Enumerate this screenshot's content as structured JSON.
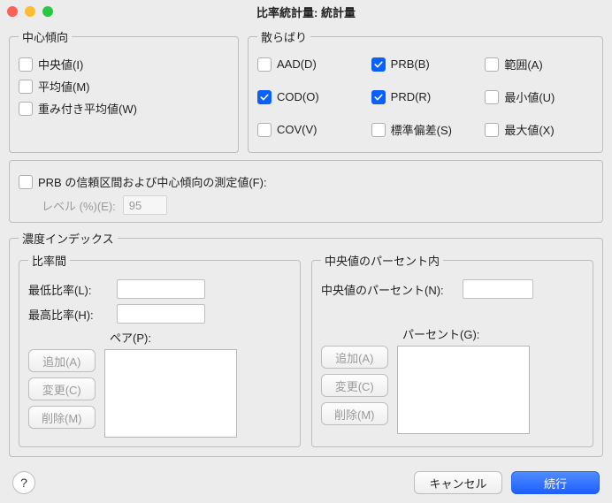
{
  "window": {
    "title": "比率統計量: 統計量"
  },
  "central": {
    "legend": "中心傾向",
    "items": [
      {
        "label": "中央値(I)",
        "checked": false,
        "name": "chk-median"
      },
      {
        "label": "平均値(M)",
        "checked": false,
        "name": "chk-mean"
      },
      {
        "label": "重み付き平均値(W)",
        "checked": false,
        "name": "chk-weighted-mean"
      }
    ]
  },
  "dispersion": {
    "legend": "散らばり",
    "items": [
      {
        "label": "AAD(D)",
        "checked": false,
        "name": "chk-aad"
      },
      {
        "label": "PRB(B)",
        "checked": true,
        "name": "chk-prb"
      },
      {
        "label": "範囲(A)",
        "checked": false,
        "name": "chk-range"
      },
      {
        "label": "COD(O)",
        "checked": true,
        "name": "chk-cod"
      },
      {
        "label": "PRD(R)",
        "checked": true,
        "name": "chk-prd"
      },
      {
        "label": "最小値(U)",
        "checked": false,
        "name": "chk-min"
      },
      {
        "label": "COV(V)",
        "checked": false,
        "name": "chk-cov"
      },
      {
        "label": "標準偏差(S)",
        "checked": false,
        "name": "chk-stddev"
      },
      {
        "label": "最大値(X)",
        "checked": false,
        "name": "chk-max"
      }
    ]
  },
  "prbSection": {
    "confLabel": "PRB の信頼区間および中心傾向の測定値(F):",
    "confChecked": false,
    "levelLabel": "レベル (%)(E):",
    "levelValue": "95"
  },
  "concentration": {
    "legend": "濃度インデックス",
    "ratio": {
      "legend": "比率間",
      "minLabel": "最低比率(L):",
      "maxLabel": "最高比率(H):",
      "minValue": "",
      "maxValue": "",
      "pairLabel": "ペア(P):",
      "addLabel": "追加(A)",
      "changeLabel": "変更(C)",
      "removeLabel": "削除(M)"
    },
    "median": {
      "legend": "中央値のパーセント内",
      "pctOfMedianLabel": "中央値のパーセント(N):",
      "pctOfMedianValue": "",
      "pctLabel": "パーセント(G):",
      "addLabel": "追加(A)",
      "changeLabel": "変更(C)",
      "removeLabel": "削除(M)"
    }
  },
  "footer": {
    "help": "?",
    "cancel": "キャンセル",
    "continue": "続行"
  }
}
